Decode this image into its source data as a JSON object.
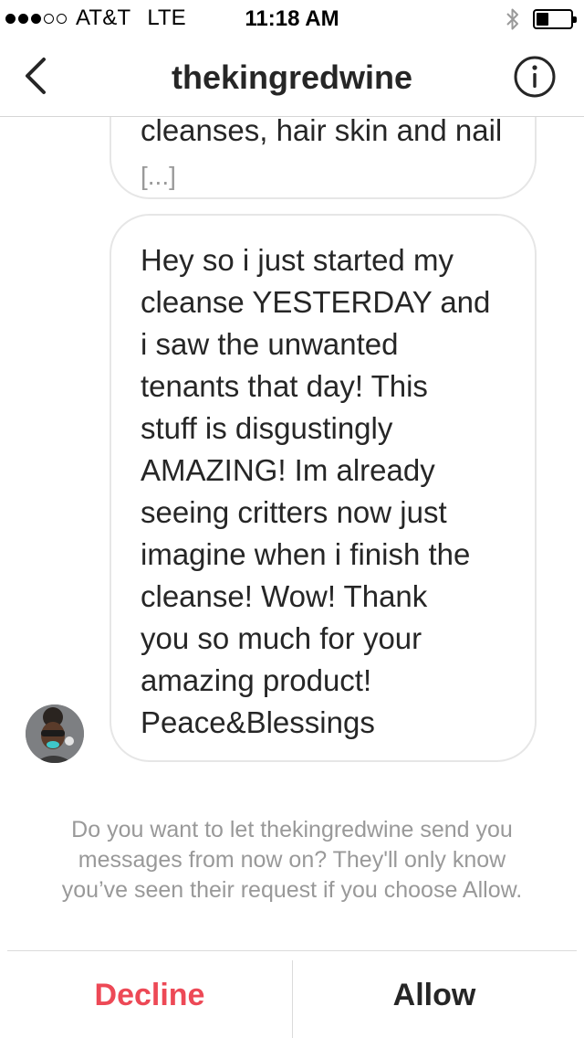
{
  "status_bar": {
    "carrier": "AT&T",
    "network": "LTE",
    "time": "11:18 AM",
    "signal_bars": 3,
    "signal_total": 5,
    "battery_level": 0.35
  },
  "nav": {
    "title": "thekingredwine",
    "back_icon": "chevron-left-icon",
    "info_icon": "info-circle-icon"
  },
  "messages": [
    {
      "lines": [
        "cleanses, hair skin and nail",
        "[...]"
      ]
    },
    {
      "lines": [
        "Hey so i just started my",
        "cleanse YESTERDAY and",
        "i saw the unwanted",
        "tenants that day! This",
        "stuff is disgustingly",
        "AMAZING! Im already",
        "seeing critters now just",
        "imagine when i finish the",
        "cleanse! Wow! Thank",
        "you so much for your",
        "amazing product!",
        "Peace&Blessings"
      ]
    }
  ],
  "request": {
    "lines": [
      "Do you want to let thekingredwine send you",
      "messages from now on? They'll only know",
      "you’ve seen their request if you choose Allow."
    ]
  },
  "actions": {
    "decline_label": "Decline",
    "allow_label": "Allow",
    "decline_color": "#ed4956"
  }
}
